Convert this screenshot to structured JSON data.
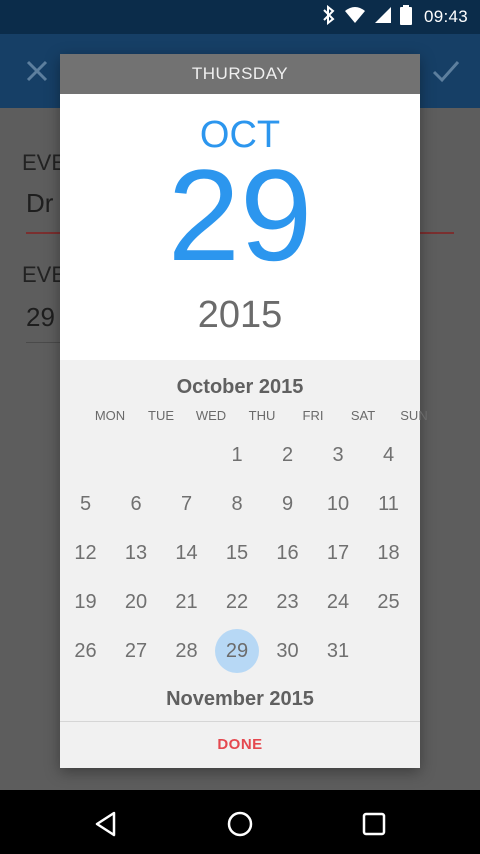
{
  "status_bar": {
    "time": "09:43",
    "icons": [
      "bluetooth-icon",
      "wifi-icon",
      "cellular-signal-icon",
      "battery-icon"
    ]
  },
  "app_bar": {
    "close_icon": "close-icon",
    "confirm_icon": "check-icon"
  },
  "form": {
    "label_1": "EVE",
    "value_1": "Dr",
    "label_2": "EVE",
    "value_2": "29"
  },
  "date_picker": {
    "day_of_week": "THURSDAY",
    "month_abbrev": "OCT",
    "day": "29",
    "year": "2015",
    "calendar_month": "October 2015",
    "next_month": "November 2015",
    "weekdays": [
      "MON",
      "TUE",
      "WED",
      "THU",
      "FRI",
      "SAT",
      "SUN"
    ],
    "days": [
      "1",
      "2",
      "3",
      "4",
      "5",
      "6",
      "7",
      "8",
      "9",
      "10",
      "11",
      "12",
      "13",
      "14",
      "15",
      "16",
      "17",
      "18",
      "19",
      "20",
      "21",
      "22",
      "23",
      "24",
      "25",
      "26",
      "27",
      "28",
      "29",
      "30",
      "31"
    ],
    "selected_day": "29",
    "done_label": "DONE"
  },
  "nav_bar": {
    "icons": [
      "back-icon",
      "home-icon",
      "recents-icon"
    ]
  },
  "colors": {
    "accent": "#2c96ee",
    "selected_day_bg": "#b7d8f5",
    "done": "#e5484f",
    "app_bar": "#163f66"
  }
}
